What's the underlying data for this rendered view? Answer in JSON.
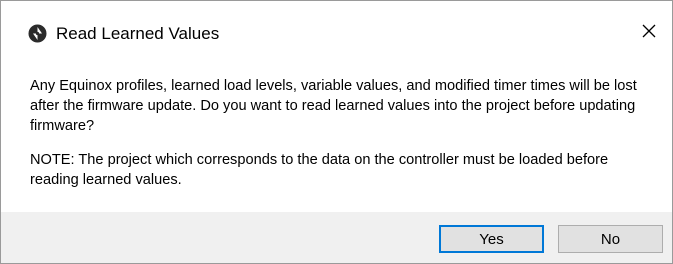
{
  "dialog": {
    "title": "Read Learned Values",
    "app_icon": "app-logo-icon",
    "close_icon": "close-icon",
    "message": {
      "paragraph1": "Any Equinox profiles, learned load levels, variable values, and modified timer times will be lost after the firmware update.  Do you want to read learned values into the project before updating firmware?",
      "paragraph2": "NOTE:  The project which corresponds to the data on the controller must be loaded before reading learned values."
    },
    "buttons": {
      "yes_label": "Yes",
      "no_label": "No"
    },
    "colors": {
      "focus_border": "#0078d7",
      "footer_bg": "#f0f0f0",
      "button_bg": "#e1e1e1"
    }
  }
}
